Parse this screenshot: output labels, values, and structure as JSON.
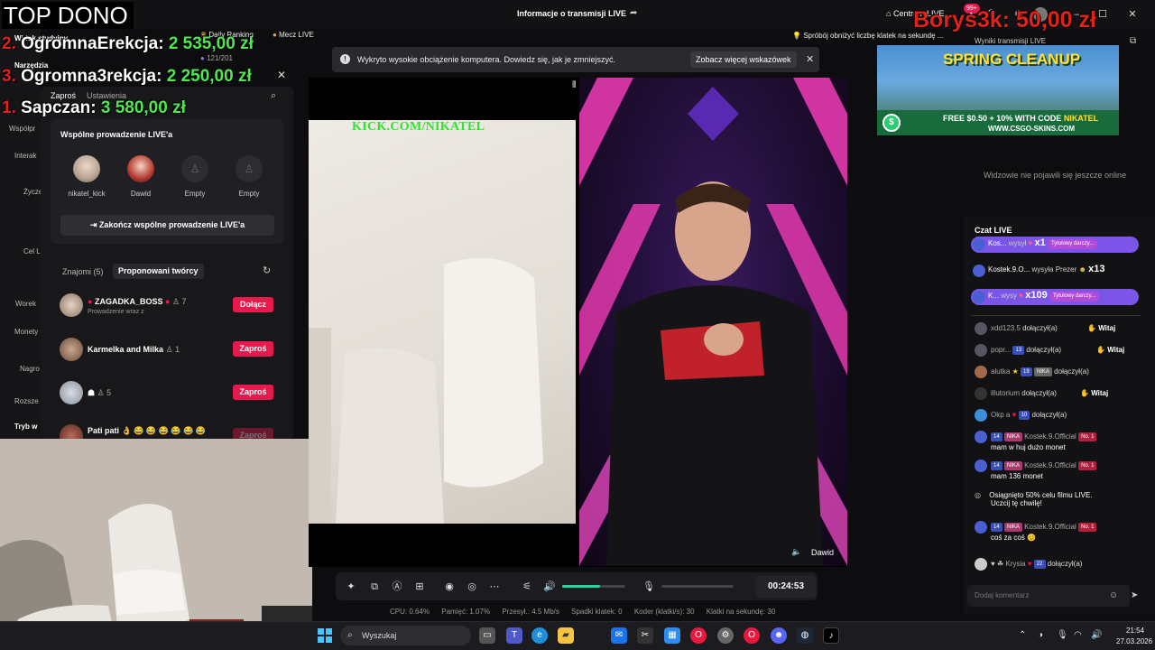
{
  "titlebar": {
    "title": "Informacje o transmisji LIVE",
    "live_center": "Centrum LIVE",
    "notif_count": "99+",
    "minimize": "—",
    "maximize": "☐",
    "close": "✕"
  },
  "overlay": {
    "top_dono": "TOP DONO",
    "donations": [
      {
        "rank": "2.",
        "name": "OgromnaErekcja:",
        "amount": "2 535,00 zł"
      },
      {
        "rank": "3.",
        "name": "Ogromna3rekcja:",
        "amount": "2 250,00 zł"
      },
      {
        "rank": "1.",
        "name": "Sapczan:",
        "amount": "3 580,00 zł"
      }
    ],
    "borys": "Borys3k: 50,00 zł"
  },
  "left": {
    "studio_view": "Widok studyjny",
    "tools": "Narzędzia",
    "interactions": "Interak",
    "wishes": "Życze wid",
    "goal": "Cel L",
    "worek": "Worek",
    "coins": "Monety",
    "rewards": "Nagro gie",
    "extend": "Rozsze",
    "mode": "Tryb w",
    "cohosts": "Współpr"
  },
  "chips": {
    "daily_ranking": "Daily Ranking",
    "match_live": "Mecz LIVE",
    "viewer_count": "121/201",
    "tip": "Spróbój obniżyć liczbę klatek na sekundę ...",
    "stream_results": "Wyniki transmisji LIVE"
  },
  "panel": {
    "tab_invite": "Zaproś",
    "tab_settings": "Ustawienia",
    "cohost_title": "Wspólne prowadzenie LIVE'a",
    "slots": [
      {
        "name": "nikatel_kick"
      },
      {
        "name": "Dawid"
      },
      {
        "name": "Empty"
      },
      {
        "name": "Empty"
      }
    ],
    "end_button": "Zakończ wspólne prowadzenie LIVE'a",
    "friends_tab": "Znajomi (5)",
    "suggested_tab": "Proponowani twórcy",
    "friends": [
      {
        "name": "ZAGADKA_BOSS",
        "count": "7",
        "sub": "Prowadzenie wraz z",
        "button": "Dołącz"
      },
      {
        "name": "Karmelka and Milka",
        "count": "1",
        "sub": "",
        "button": "Zaproś"
      },
      {
        "name": "☗",
        "count": "5",
        "sub": "",
        "button": "Zaproś"
      },
      {
        "name": "Pati pati 👌 😂 😂 😂 😂 😂 😂",
        "count": "",
        "sub": "",
        "button": "Zaproś"
      }
    ]
  },
  "notification": {
    "text": "Wykryto wysokie obciążenie komputera. Dowiedz się, jak je zmniejszyć.",
    "button": "Zobacz więcej wskazówek",
    "close": "✕"
  },
  "stream": {
    "kick_url": "KICK.COM/NIKATEL",
    "guest_name": "Dawid",
    "timer": "00:24:53",
    "volume_level": 0.6
  },
  "stats": {
    "cpu": "CPU: 0.64%",
    "memory": "Pamięć: 1.07%",
    "upload": "Przesył.: 4.5 Mb/s",
    "frame_drops": "Spadki klatek: 0",
    "encoder": "Koder (klatki/s): 30",
    "fps": "Klatki na sekundę: 30"
  },
  "ad": {
    "title": "SPRING CLEANUP",
    "line1_a": "FREE $0.50 + 10% WITH CODE",
    "line1_b": "NIKATEL",
    "line2": "WWW.CSGO-SKINS.COM"
  },
  "viewers_empty": "Widzowie nie pojawili się jeszcze online",
  "chat": {
    "title": "Czat LIVE",
    "gifts": [
      {
        "user": "Kos...",
        "action": "wysył",
        "count": "x1",
        "tag": "Tytułowy darczy..."
      },
      {
        "user": "Kostek.9.O...",
        "action": "wysyła Prezer",
        "count": "x13",
        "tag": ""
      },
      {
        "user": "K...",
        "action": "wysy",
        "count": "x109",
        "tag": "Tytułowy darczy..."
      }
    ],
    "messages": [
      {
        "user": "xdd123.5",
        "badge": "",
        "badge2": "",
        "text": "dołączył(a)",
        "msg": "",
        "witaj": "Witaj"
      },
      {
        "user": "popr...",
        "badge": "13",
        "badge2": "",
        "text": "dołączył(a)",
        "msg": "",
        "witaj": "Witaj"
      },
      {
        "user": "alutka",
        "badge": "19",
        "badge2": "NIKA",
        "text": "dołączył(a)",
        "msg": "",
        "witaj": ""
      },
      {
        "user": "illutorium",
        "badge": "",
        "badge2": "",
        "text": "dołączył(a)",
        "msg": "",
        "witaj": "Witaj"
      },
      {
        "user": "Okp a",
        "badge": "10",
        "badge2": "",
        "text": "dołączył(a)",
        "msg": "",
        "witaj": ""
      },
      {
        "user": "Kostek.9.Official",
        "badge": "14",
        "badge2": "NIKA",
        "badge3": "No. 1",
        "text": "",
        "msg": "mam w huj dużo monet",
        "witaj": ""
      },
      {
        "user": "Kostek.9.Official",
        "badge": "14",
        "badge2": "NIKA",
        "badge3": "No. 1",
        "text": "",
        "msg": "mam 136 monet",
        "witaj": ""
      },
      {
        "user": "",
        "badge": "",
        "badge2": "",
        "text": "Osiągnięto 50% celu filmu LIVE.",
        "msg": "Uczcij tę chwilę!",
        "witaj": ""
      },
      {
        "user": "Kostek.9.Official",
        "badge": "14",
        "badge2": "NIKA",
        "badge3": "No. 1",
        "text": "",
        "msg": "coś za coś 😊",
        "witaj": ""
      },
      {
        "user": "Krysia",
        "badge": "22",
        "badge2": "",
        "text": "dołączył(a)",
        "msg": "",
        "witaj": ""
      }
    ],
    "comment_placeholder": "Dodaj komentarz"
  },
  "taskbar": {
    "search": "Wyszukaj",
    "time": "21:54",
    "date": "27.03.2026"
  },
  "colors": {
    "accent": "#e8194d",
    "donation_amount": "#4fe84f",
    "donation_rank": "#e0221b",
    "volume": "#19d9a0"
  }
}
